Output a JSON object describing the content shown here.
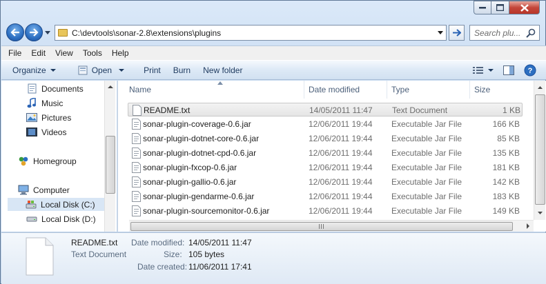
{
  "window": {
    "title": ""
  },
  "address": {
    "path": "C:\\devtools\\sonar-2.8\\extensions\\plugins"
  },
  "search": {
    "placeholder": "Search plu..."
  },
  "menu": [
    "File",
    "Edit",
    "View",
    "Tools",
    "Help"
  ],
  "toolbar": {
    "organize": "Organize",
    "open": "Open",
    "print": "Print",
    "burn": "Burn",
    "new_folder": "New folder"
  },
  "nav": {
    "documents": "Documents",
    "music": "Music",
    "pictures": "Pictures",
    "videos": "Videos",
    "homegroup": "Homegroup",
    "computer": "Computer",
    "local_c": "Local Disk (C:)",
    "local_d": "Local Disk (D:)"
  },
  "columns": {
    "name": "Name",
    "date": "Date modified",
    "type": "Type",
    "size": "Size"
  },
  "files": [
    {
      "name": "README.txt",
      "date": "14/05/2011 11:47",
      "type": "Text Document",
      "size": "1 KB",
      "icon": "text-file-icon",
      "selected": true
    },
    {
      "name": "sonar-plugin-coverage-0.6.jar",
      "date": "12/06/2011 19:44",
      "type": "Executable Jar File",
      "size": "166 KB",
      "icon": "jar-file-icon"
    },
    {
      "name": "sonar-plugin-dotnet-core-0.6.jar",
      "date": "12/06/2011 19:44",
      "type": "Executable Jar File",
      "size": "85 KB",
      "icon": "jar-file-icon"
    },
    {
      "name": "sonar-plugin-dotnet-cpd-0.6.jar",
      "date": "12/06/2011 19:44",
      "type": "Executable Jar File",
      "size": "135 KB",
      "icon": "jar-file-icon"
    },
    {
      "name": "sonar-plugin-fxcop-0.6.jar",
      "date": "12/06/2011 19:44",
      "type": "Executable Jar File",
      "size": "181 KB",
      "icon": "jar-file-icon"
    },
    {
      "name": "sonar-plugin-gallio-0.6.jar",
      "date": "12/06/2011 19:44",
      "type": "Executable Jar File",
      "size": "142 KB",
      "icon": "jar-file-icon"
    },
    {
      "name": "sonar-plugin-gendarme-0.6.jar",
      "date": "12/06/2011 19:44",
      "type": "Executable Jar File",
      "size": "183 KB",
      "icon": "jar-file-icon"
    },
    {
      "name": "sonar-plugin-sourcemonitor-0.6.jar",
      "date": "12/06/2011 19:44",
      "type": "Executable Jar File",
      "size": "149 KB",
      "icon": "jar-file-icon"
    }
  ],
  "details": {
    "name": "README.txt",
    "type": "Text Document",
    "modified_label": "Date modified:",
    "modified": "14/05/2011 11:47",
    "size_label": "Size:",
    "size": "105 bytes",
    "created_label": "Date created:",
    "created": "11/06/2011 17:41"
  }
}
